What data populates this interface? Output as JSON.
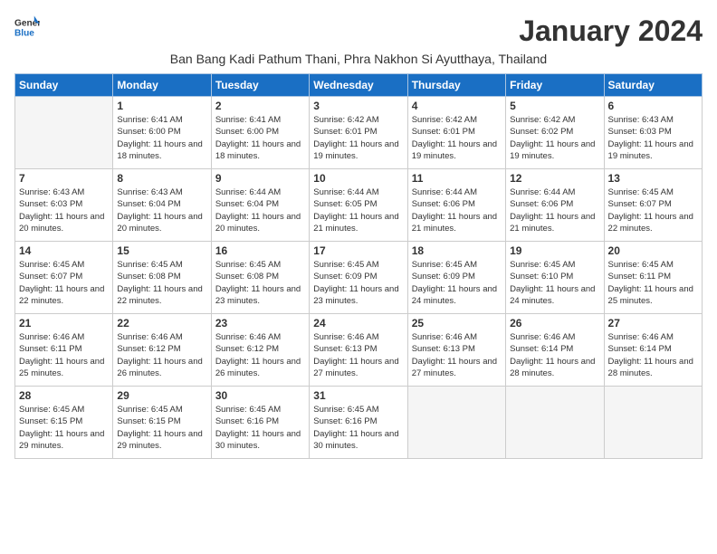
{
  "logo": {
    "line1": "General",
    "line2": "Blue"
  },
  "title": "January 2024",
  "subtitle": "Ban Bang Kadi Pathum Thani, Phra Nakhon Si Ayutthaya, Thailand",
  "headers": [
    "Sunday",
    "Monday",
    "Tuesday",
    "Wednesday",
    "Thursday",
    "Friday",
    "Saturday"
  ],
  "weeks": [
    [
      {
        "day": "",
        "empty": true
      },
      {
        "day": "1",
        "sunrise": "6:41 AM",
        "sunset": "6:00 PM",
        "daylight": "11 hours and 18 minutes."
      },
      {
        "day": "2",
        "sunrise": "6:41 AM",
        "sunset": "6:00 PM",
        "daylight": "11 hours and 18 minutes."
      },
      {
        "day": "3",
        "sunrise": "6:42 AM",
        "sunset": "6:01 PM",
        "daylight": "11 hours and 19 minutes."
      },
      {
        "day": "4",
        "sunrise": "6:42 AM",
        "sunset": "6:01 PM",
        "daylight": "11 hours and 19 minutes."
      },
      {
        "day": "5",
        "sunrise": "6:42 AM",
        "sunset": "6:02 PM",
        "daylight": "11 hours and 19 minutes."
      },
      {
        "day": "6",
        "sunrise": "6:43 AM",
        "sunset": "6:03 PM",
        "daylight": "11 hours and 19 minutes."
      }
    ],
    [
      {
        "day": "7",
        "sunrise": "6:43 AM",
        "sunset": "6:03 PM",
        "daylight": "11 hours and 20 minutes."
      },
      {
        "day": "8",
        "sunrise": "6:43 AM",
        "sunset": "6:04 PM",
        "daylight": "11 hours and 20 minutes."
      },
      {
        "day": "9",
        "sunrise": "6:44 AM",
        "sunset": "6:04 PM",
        "daylight": "11 hours and 20 minutes."
      },
      {
        "day": "10",
        "sunrise": "6:44 AM",
        "sunset": "6:05 PM",
        "daylight": "11 hours and 21 minutes."
      },
      {
        "day": "11",
        "sunrise": "6:44 AM",
        "sunset": "6:06 PM",
        "daylight": "11 hours and 21 minutes."
      },
      {
        "day": "12",
        "sunrise": "6:44 AM",
        "sunset": "6:06 PM",
        "daylight": "11 hours and 21 minutes."
      },
      {
        "day": "13",
        "sunrise": "6:45 AM",
        "sunset": "6:07 PM",
        "daylight": "11 hours and 22 minutes."
      }
    ],
    [
      {
        "day": "14",
        "sunrise": "6:45 AM",
        "sunset": "6:07 PM",
        "daylight": "11 hours and 22 minutes."
      },
      {
        "day": "15",
        "sunrise": "6:45 AM",
        "sunset": "6:08 PM",
        "daylight": "11 hours and 22 minutes."
      },
      {
        "day": "16",
        "sunrise": "6:45 AM",
        "sunset": "6:08 PM",
        "daylight": "11 hours and 23 minutes."
      },
      {
        "day": "17",
        "sunrise": "6:45 AM",
        "sunset": "6:09 PM",
        "daylight": "11 hours and 23 minutes."
      },
      {
        "day": "18",
        "sunrise": "6:45 AM",
        "sunset": "6:09 PM",
        "daylight": "11 hours and 24 minutes."
      },
      {
        "day": "19",
        "sunrise": "6:45 AM",
        "sunset": "6:10 PM",
        "daylight": "11 hours and 24 minutes."
      },
      {
        "day": "20",
        "sunrise": "6:45 AM",
        "sunset": "6:11 PM",
        "daylight": "11 hours and 25 minutes."
      }
    ],
    [
      {
        "day": "21",
        "sunrise": "6:46 AM",
        "sunset": "6:11 PM",
        "daylight": "11 hours and 25 minutes."
      },
      {
        "day": "22",
        "sunrise": "6:46 AM",
        "sunset": "6:12 PM",
        "daylight": "11 hours and 26 minutes."
      },
      {
        "day": "23",
        "sunrise": "6:46 AM",
        "sunset": "6:12 PM",
        "daylight": "11 hours and 26 minutes."
      },
      {
        "day": "24",
        "sunrise": "6:46 AM",
        "sunset": "6:13 PM",
        "daylight": "11 hours and 27 minutes."
      },
      {
        "day": "25",
        "sunrise": "6:46 AM",
        "sunset": "6:13 PM",
        "daylight": "11 hours and 27 minutes."
      },
      {
        "day": "26",
        "sunrise": "6:46 AM",
        "sunset": "6:14 PM",
        "daylight": "11 hours and 28 minutes."
      },
      {
        "day": "27",
        "sunrise": "6:46 AM",
        "sunset": "6:14 PM",
        "daylight": "11 hours and 28 minutes."
      }
    ],
    [
      {
        "day": "28",
        "sunrise": "6:45 AM",
        "sunset": "6:15 PM",
        "daylight": "11 hours and 29 minutes."
      },
      {
        "day": "29",
        "sunrise": "6:45 AM",
        "sunset": "6:15 PM",
        "daylight": "11 hours and 29 minutes."
      },
      {
        "day": "30",
        "sunrise": "6:45 AM",
        "sunset": "6:16 PM",
        "daylight": "11 hours and 30 minutes."
      },
      {
        "day": "31",
        "sunrise": "6:45 AM",
        "sunset": "6:16 PM",
        "daylight": "11 hours and 30 minutes."
      },
      {
        "day": "",
        "empty": true
      },
      {
        "day": "",
        "empty": true
      },
      {
        "day": "",
        "empty": true
      }
    ]
  ]
}
